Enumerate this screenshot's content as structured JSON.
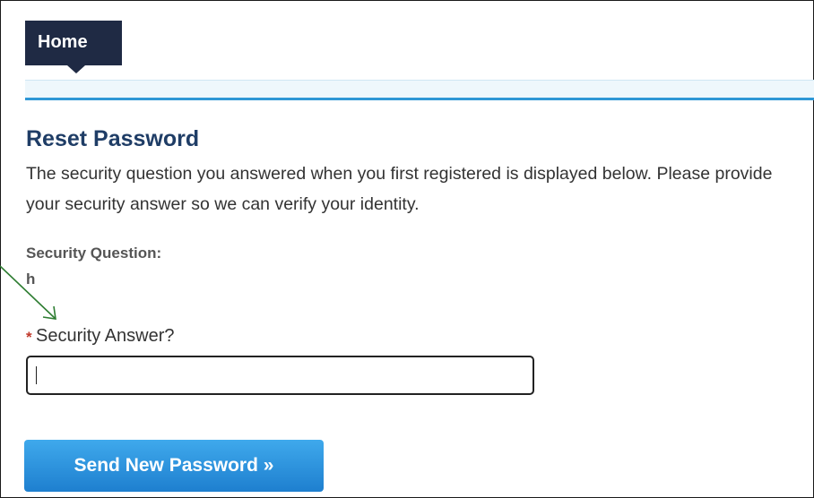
{
  "nav": {
    "home_label": "Home"
  },
  "page": {
    "title": "Reset Password",
    "intro": "The security question you answered when you first registered is displayed below. Please provide your security answer so we can verify your identity."
  },
  "security_question": {
    "label": "Security Question:",
    "value": "h"
  },
  "security_answer": {
    "required_marker": "*",
    "label": "Security Answer?",
    "value": ""
  },
  "actions": {
    "send_label": "Send New Password »"
  },
  "colors": {
    "nav_dark": "#1f2a44",
    "title_blue": "#1f3d66",
    "rule_blue": "#2e97d6",
    "button_blue": "#2b94dd",
    "required_red": "#c0392b",
    "annotation_green": "#2e7d32"
  },
  "icons": {
    "annotation": "arrow-pointer-icon"
  }
}
